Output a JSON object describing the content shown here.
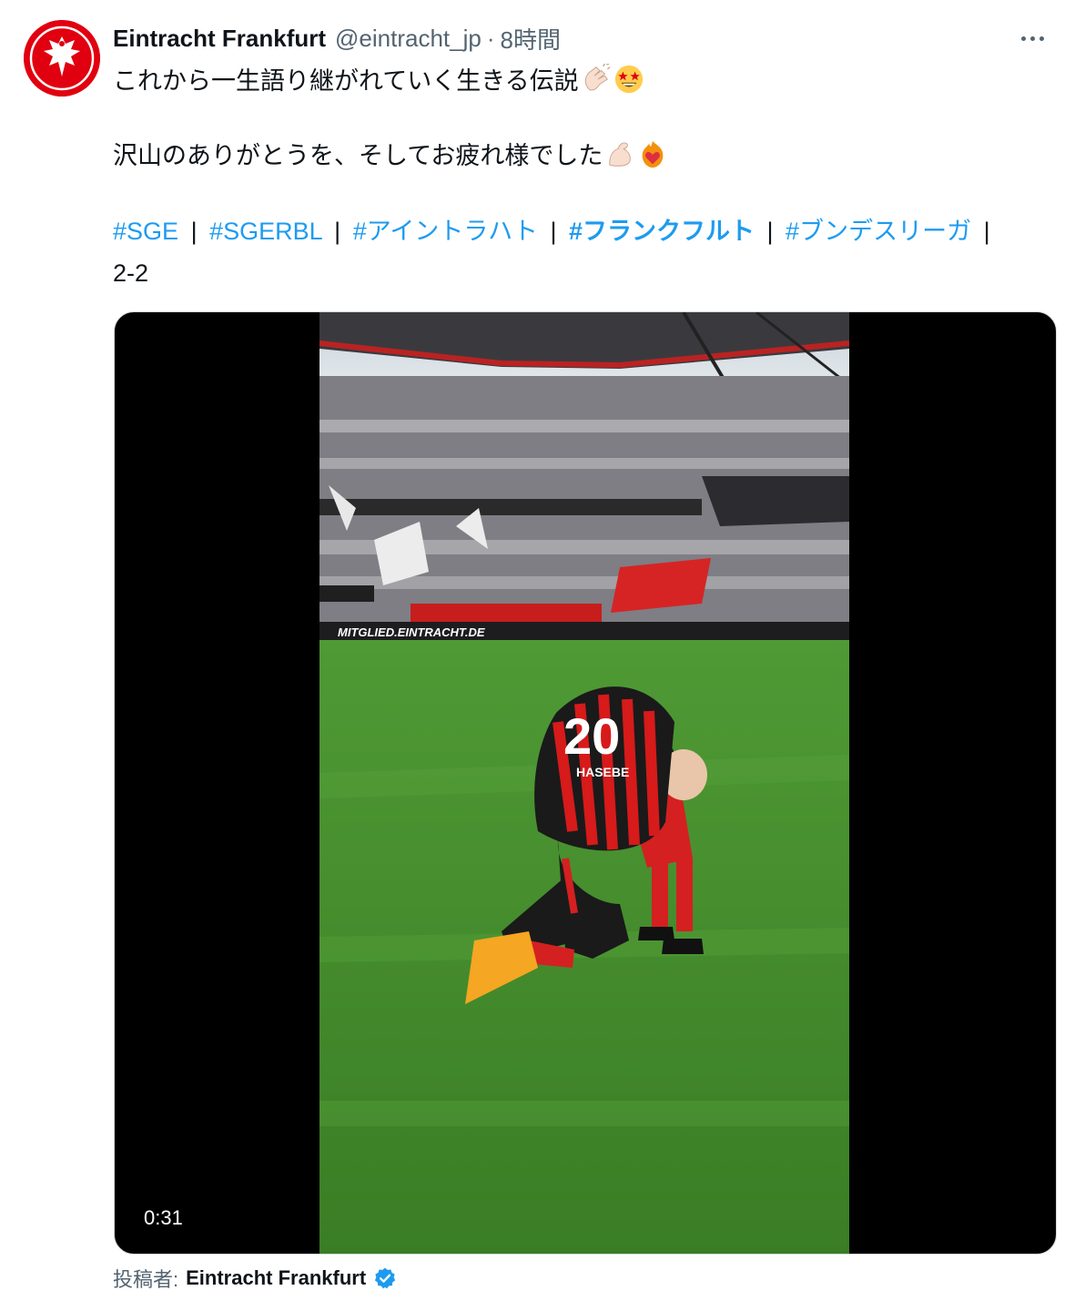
{
  "tweet": {
    "author_name": "Eintracht Frankfurt",
    "handle": "@eintracht_jp",
    "separator": "·",
    "time": "8時間",
    "line1": "これから一生語り継がれていく生きる伝説",
    "line2": "沢山のありがとうを、そしてお疲れ様でした",
    "hashtags": [
      "#SGE",
      "#SGERBL",
      "#アイントラハト",
      "#フランクフルト",
      "#ブンデスリーガ"
    ],
    "tag_separator": "|",
    "score": "2-2",
    "emoji_line1": [
      "clapping-hands-icon",
      "star-struck-icon"
    ],
    "emoji_line2": [
      "flexed-biceps-icon",
      "heart-on-fire-icon"
    ]
  },
  "media": {
    "duration": "0:31",
    "jersey_number": "20",
    "jersey_name": "HASEBE",
    "banner_text": "MITGLIED.EINTRACHT.DE"
  },
  "byline": {
    "prefix": "投稿者:",
    "name": "Eintracht Frankfurt"
  },
  "colors": {
    "brand_red": "#e1000f",
    "link_blue": "#1d9bf0",
    "secondary_text": "#536471",
    "pitch_green": "#3f8a2a"
  }
}
